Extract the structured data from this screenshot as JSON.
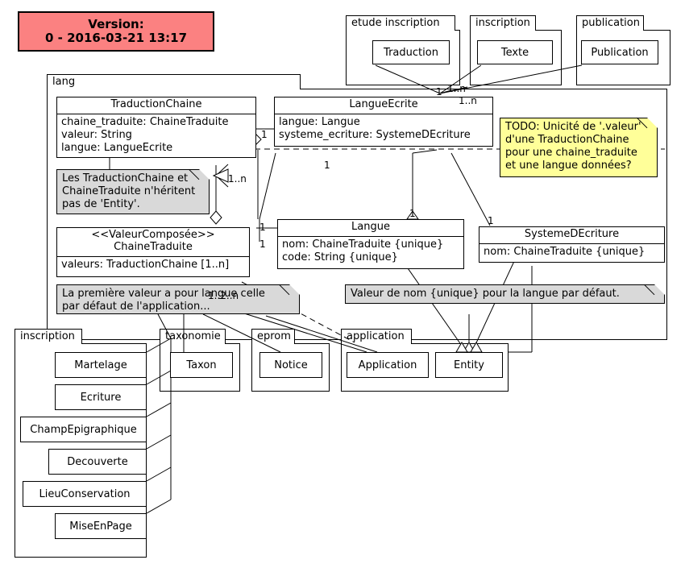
{
  "version_banner": {
    "label": "Version:",
    "value": "0 - 2016-03-21 13:17",
    "color": "#fb8181"
  },
  "packages": {
    "lang": {
      "name": "lang"
    },
    "etude_inscription": {
      "name": "etude inscription"
    },
    "inscription_top": {
      "name": "inscription"
    },
    "publication": {
      "name": "publication"
    },
    "inscription_bottom": {
      "name": "inscription"
    },
    "taxonomie": {
      "name": "taxonomie"
    },
    "eprom": {
      "name": "eprom"
    },
    "application": {
      "name": "application"
    }
  },
  "classes": {
    "traduction_chaine": {
      "name": "TraductionChaine",
      "attributes": [
        "chaine_traduite: ChaineTraduite",
        "valeur: String",
        "langue: LangueEcrite"
      ]
    },
    "langue_ecrite": {
      "name": "LangueEcrite",
      "attributes": [
        "langue: Langue",
        "systeme_ecriture: SystemeDEcriture"
      ]
    },
    "chaine_traduite": {
      "stereotype": "<<ValeurComposée>>",
      "name": "ChaineTraduite",
      "attributes": [
        "valeurs: TraductionChaine [1..n]"
      ]
    },
    "langue": {
      "name": "Langue",
      "attributes": [
        "nom: ChaineTraduite {unique}",
        "code: String {unique}"
      ]
    },
    "systeme_decriture": {
      "name": "SystemeDEcriture",
      "attributes": [
        "nom: ChaineTraduite {unique}"
      ]
    },
    "traduction": {
      "name": "Traduction"
    },
    "texte": {
      "name": "Texte"
    },
    "publication": {
      "name": "Publication"
    },
    "martelage": {
      "name": "Martelage"
    },
    "ecriture": {
      "name": "Ecriture"
    },
    "champ_epigraphique": {
      "name": "ChampEpigraphique"
    },
    "decouverte": {
      "name": "Decouverte"
    },
    "lieu_conservation": {
      "name": "LieuConservation"
    },
    "mise_en_page": {
      "name": "MiseEnPage"
    },
    "taxon": {
      "name": "Taxon"
    },
    "notice": {
      "name": "Notice"
    },
    "application": {
      "name": "Application"
    },
    "entity": {
      "name": "Entity"
    }
  },
  "notes": {
    "heritage": {
      "color": "#d9d9d9",
      "lines": [
        "Les TraductionChaine et",
        "ChaineTraduite n'héritent",
        "pas de 'Entity'."
      ]
    },
    "premiere_valeur": {
      "color": "#d9d9d9",
      "lines": [
        "La première valeur a pour langue celle",
        "par défaut de l'application..."
      ]
    },
    "valeur_nom": {
      "color": "#d9d9d9",
      "lines": [
        "Valeur de nom {unique} pour la langue par défaut."
      ]
    },
    "todo": {
      "color": "#ffff99",
      "lines": [
        "TODO: Unicité de '.valeur'",
        "d'une TraductionChaine",
        "pour une chaine_traduite",
        "et une langue données?"
      ]
    }
  },
  "multiplicities": {
    "m1": "1",
    "m2": "1..n",
    "m3": "1",
    "m4": "1..n",
    "m5": "1..n",
    "m6": "1",
    "m7": "1",
    "m8": "1",
    "m9": "1",
    "m10": "1",
    "m11": "1",
    "m12": "1..2..n"
  }
}
